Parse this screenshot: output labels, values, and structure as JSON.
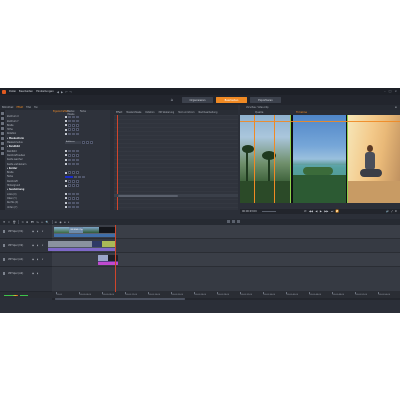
{
  "menu": {
    "items": [
      "Datei",
      "Bearbeiten",
      "Einstellungen"
    ],
    "history": [
      "◀",
      "▶",
      "↶",
      "↷"
    ]
  },
  "modes": [
    "Organisieren",
    "Bearbeiten",
    "Exportieren"
  ],
  "active_mode": "Bearbeiten",
  "left_panel": {
    "tabs": [
      "Bibliothek",
      "Effekt",
      "Titel",
      "Ton"
    ],
    "active_tab": "Effekt",
    "columns": [
      "Eigenschaften",
      "Master-Maske",
      "Farbe"
    ],
    "rows": [
      {
        "label": "Zentrum X",
        "type": "spin"
      },
      {
        "label": "Zentrum Y",
        "type": "spin"
      },
      {
        "label": "Breite",
        "type": "spin"
      },
      {
        "label": "Höhe",
        "type": "spin"
      },
      {
        "label": "Rotation",
        "type": "spin"
      },
      {
        "label": "▾ Maskenform",
        "type": "section"
      },
      {
        "label": "Maskenmodus",
        "type": "dropdown",
        "value": "Addieren"
      },
      {
        "label": "▾ Randbild",
        "type": "section"
      },
      {
        "label": "Randbild",
        "type": "spin"
      },
      {
        "label": "Deckkraft außen",
        "type": "spin"
      },
      {
        "label": "Kante weicher",
        "type": "spin"
      },
      {
        "label": "Kante verkleinern",
        "type": "spin"
      },
      {
        "label": "▾ Kontur",
        "type": "section"
      },
      {
        "label": "Breite",
        "type": "spin"
      },
      {
        "label": "Farbe",
        "type": "color",
        "color": "#1a2cc8"
      },
      {
        "label": "Deckkraft",
        "type": "spin"
      },
      {
        "label": "Hintergrund",
        "type": "spin"
      },
      {
        "label": "▾ Ausdehnung",
        "type": "section"
      },
      {
        "label": "Links (X)",
        "type": "spin"
      },
      {
        "label": "Oben (Y)",
        "type": "spin"
      },
      {
        "label": "Rechts (X)",
        "type": "spin"
      },
      {
        "label": "Unten (Y)",
        "type": "spin"
      }
    ]
  },
  "keyframe_columns": [
    "Effekt",
    "Master-Maske",
    "Rotation",
    "Mit Skalierung",
    "Text und Zoom",
    "Nachbearbeitung"
  ],
  "player": {
    "header": "Vorschau: Video-Clip",
    "sub_tabs": [
      "Quelle",
      "Timeline"
    ],
    "active_sub_tab": "Timeline",
    "timecode": "00:00:03:09",
    "transport": [
      "⏮",
      "◀◀",
      "◀",
      "▶",
      "▶▶",
      "⏭",
      "🔁"
    ],
    "right_controls": [
      "🔊",
      "⤢",
      "⚙"
    ]
  },
  "timeline_toolbar": [
    "⚑",
    "✂",
    "🗑",
    "⟲",
    "⊞",
    "🎞",
    "⇆",
    "↔",
    "🔍",
    "☰",
    "◉",
    "⏺",
    "⏸"
  ],
  "tracks": [
    {
      "name": "VIP Spur (V1)"
    },
    {
      "name": "VIP Spur (V2)"
    },
    {
      "name": "VIP Spur (A1)"
    },
    {
      "name": "VIP Spur (A2)"
    }
  ],
  "clips": [
    {
      "title": "ORIGINAL Clip",
      "track": 0
    },
    {
      "title": "Clip 2 (audio)",
      "track": 1
    },
    {
      "title": "Clip 3",
      "track": 2
    }
  ],
  "ruler_ticks": [
    "00:00",
    "00:00:04:00",
    "00:00:08:00",
    "00:00:12:00",
    "00:00:16:00",
    "00:00:20:00",
    "00:00:24:00",
    "00:00:28:00",
    "00:00:32:00",
    "00:00:36:00",
    "00:00:40:00",
    "00:00:44:00",
    "00:00:48:00",
    "00:00:52:00",
    "00:00:56:00"
  ],
  "colors": {
    "accent": "#f08a24",
    "playhead": "#d0452b",
    "background": "#2b2f38"
  }
}
